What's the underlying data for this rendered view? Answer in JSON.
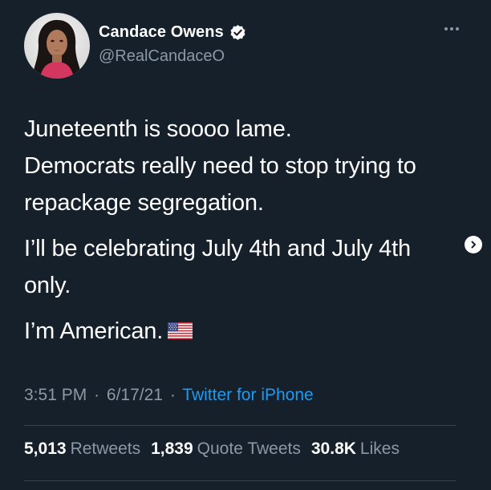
{
  "author": {
    "display_name": "Candace Owens",
    "handle": "@RealCandaceO",
    "verified": true,
    "avatar_icon": "profile-photo"
  },
  "tweet": {
    "paragraphs": [
      [
        "Juneteenth is soooo lame.",
        "Democrats really need to stop trying to",
        "repackage segregation."
      ],
      [
        "I’ll be celebrating July 4th and July 4th",
        "only."
      ],
      [
        "I’m American."
      ]
    ],
    "emoji": "us-flag-icon"
  },
  "meta": {
    "time": "3:51 PM",
    "separator": "·",
    "date": "6/17/21",
    "source": "Twitter for iPhone"
  },
  "stats": {
    "retweets_count": "5,013",
    "retweets_label": "Retweets",
    "quotes_count": "1,839",
    "quotes_label": "Quote Tweets",
    "likes_count": "30.8K",
    "likes_label": "Likes"
  },
  "colors": {
    "background": "#15202b",
    "primary_text": "#ffffff",
    "secondary_text": "#8b98a5",
    "link_blue": "#1d9bf0",
    "divider": "#38444d"
  }
}
